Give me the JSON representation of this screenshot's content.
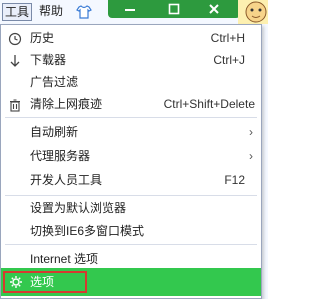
{
  "toolbar": {
    "tools_label": "工具",
    "help_label": "帮助",
    "min_symbol": "—",
    "max_symbol": "□",
    "close_symbol": "✕"
  },
  "menu": {
    "items": [
      {
        "label": "历史",
        "shortcut": "Ctrl+H",
        "icon": "clock-icon"
      },
      {
        "label": "下载器",
        "shortcut": "Ctrl+J",
        "icon": "download-arrow-icon"
      },
      {
        "label": "广告过滤",
        "shortcut": ""
      },
      {
        "label": "清除上网痕迹",
        "shortcut": "Ctrl+Shift+Delete",
        "icon": "trash-icon"
      },
      {
        "label": "自动刷新",
        "submenu": true
      },
      {
        "label": "代理服务器",
        "submenu": true
      },
      {
        "label": "开发人员工具",
        "shortcut": "F12"
      },
      {
        "label": "设置为默认浏览器"
      },
      {
        "label": "切换到IE6多窗口模式"
      },
      {
        "label": "Internet 选项"
      },
      {
        "label": "选项",
        "icon": "gear-icon",
        "highlighted": true
      }
    ],
    "submenu_arrow": "›"
  },
  "colors": {
    "highlight_green": "#33c84e",
    "annotation_red": "#d63a30",
    "window_controls_green": "#2d9a3e"
  }
}
